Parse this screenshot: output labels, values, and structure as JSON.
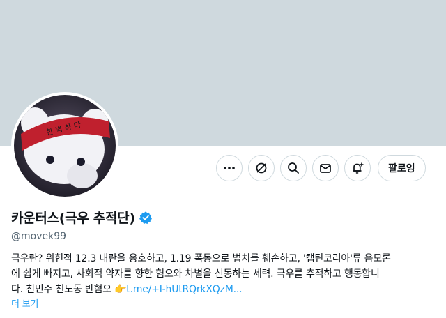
{
  "profile": {
    "display_name": "카운터스(극우 추적단)",
    "handle": "@movek99",
    "verified": true,
    "avatar_text": "한 벽 하 다",
    "bio": {
      "line1": "극우란? 위헌적 12.3 내란을 옹호하고, 1.19 폭동으로 법치를 훼손하고, '캡틴코리아'류 음모론",
      "line2": "에 쉽게 빠지고, 사회적 약자를 향한 혐오와 차별을 선동하는 세력. 극우를 추적하고 행동합니",
      "line3_text": "다. 친민주 친노동 반혐오 ",
      "line3_emoji": "👉",
      "line3_link": "t.me/+I-hUtRQrkXQzM...",
      "more_label": "더 보기"
    }
  },
  "actions": {
    "more_icon": "more-icon",
    "grok_icon": "grok-icon",
    "search_icon": "search-icon",
    "message_icon": "mail-icon",
    "notify_icon": "bell-plus-icon",
    "follow_label": "팔로잉"
  },
  "colors": {
    "banner": "#cfd9de",
    "link": "#1d9bf0",
    "verified": "#1d9bf0",
    "muted": "#536471",
    "avatar_band": "#c0202e"
  }
}
